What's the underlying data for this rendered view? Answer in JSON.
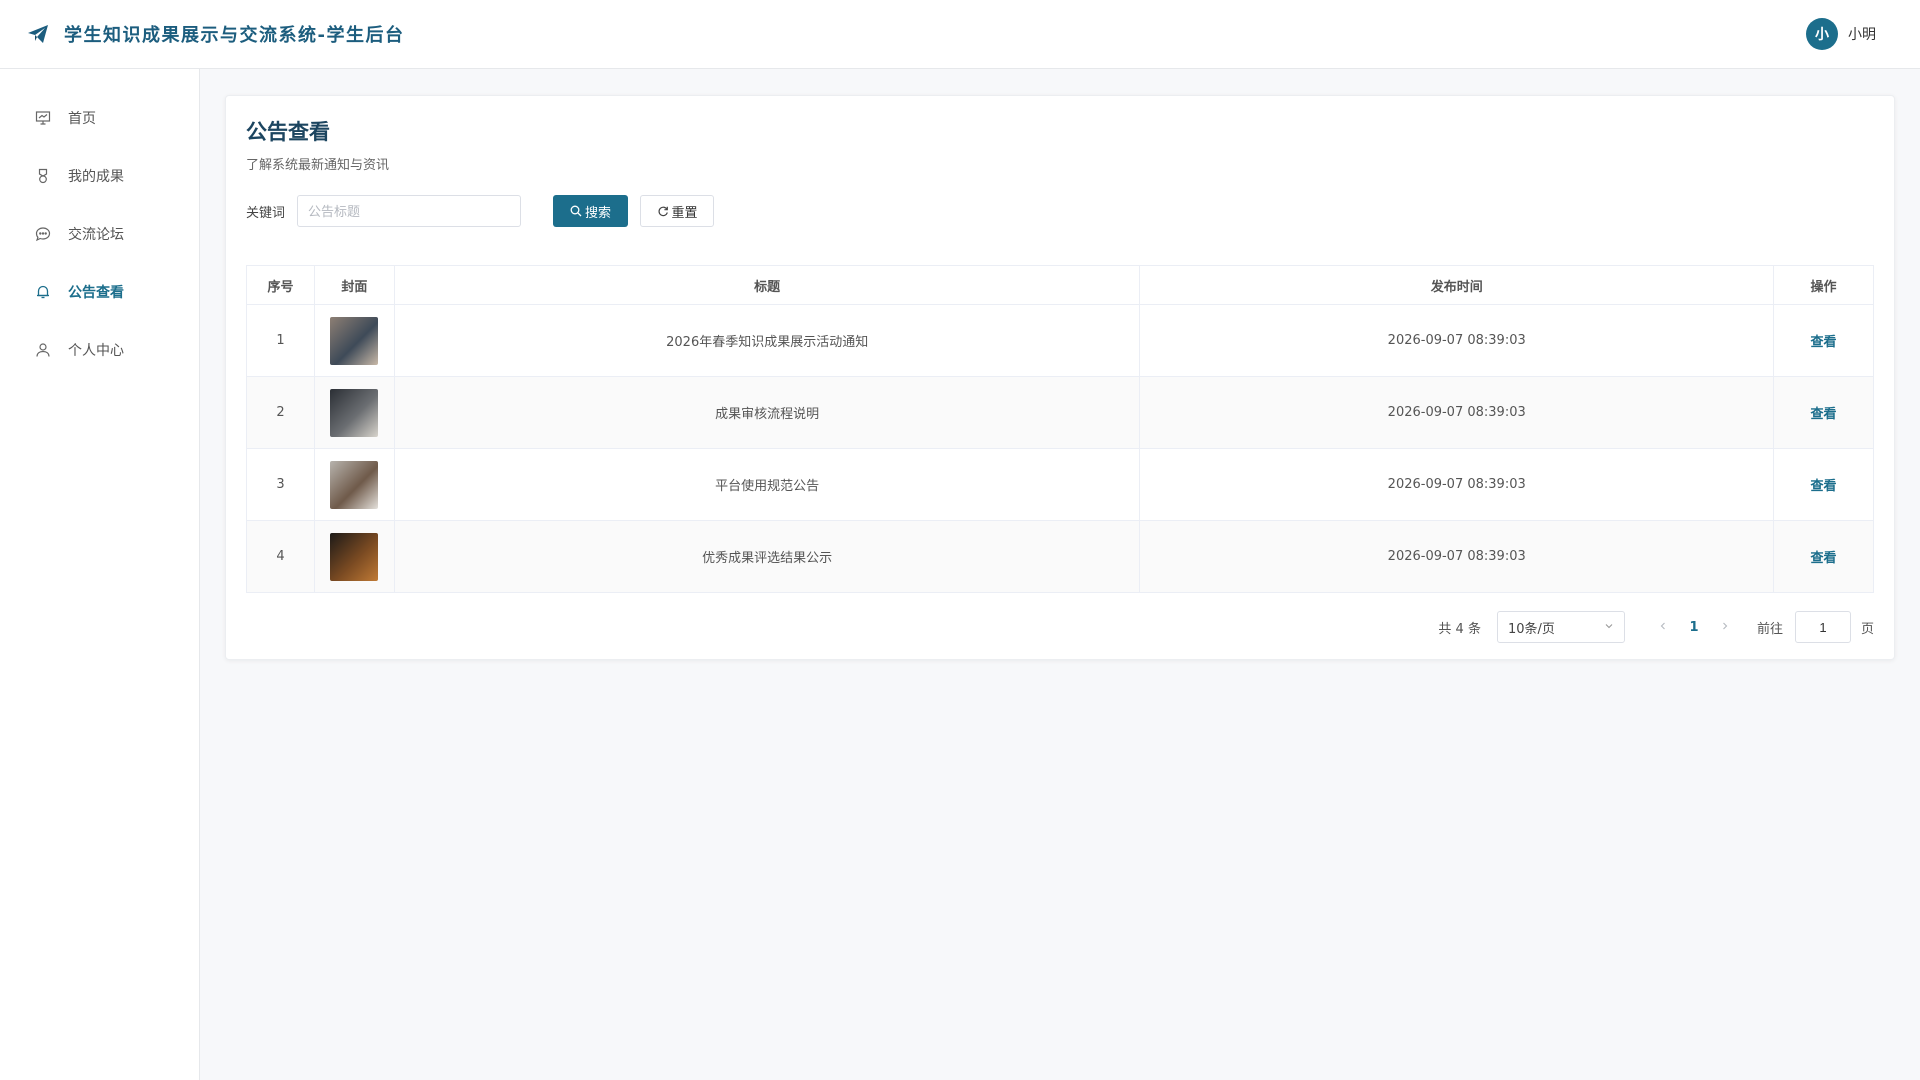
{
  "header": {
    "title": "学生知识成果展示与交流系统-学生后台",
    "avatar_text": "小",
    "user_name": "小明"
  },
  "sidebar": {
    "items": [
      {
        "label": "首页",
        "icon": "presentation-icon",
        "active": false
      },
      {
        "label": "我的成果",
        "icon": "medal-icon",
        "active": false
      },
      {
        "label": "交流论坛",
        "icon": "chat-icon",
        "active": false
      },
      {
        "label": "公告查看",
        "icon": "bell-icon",
        "active": true
      },
      {
        "label": "个人中心",
        "icon": "user-icon",
        "active": false
      }
    ]
  },
  "main": {
    "title": "公告查看",
    "subtitle": "了解系统最新通知与资讯",
    "search": {
      "label": "关键词",
      "placeholder": "公告标题",
      "value": "",
      "search_label": "搜索",
      "reset_label": "重置"
    },
    "table": {
      "columns": [
        "序号",
        "封面",
        "标题",
        "发布时间",
        "操作"
      ],
      "rows": [
        {
          "index": "1",
          "title": "2026年春季知识成果展示活动通知",
          "time": "2026-09-07 08:39:03",
          "action": "查看",
          "thumb_colors": [
            "#8d7f74",
            "#3e4a58",
            "#c9b9a8"
          ]
        },
        {
          "index": "2",
          "title": "成果审核流程说明",
          "time": "2026-09-07 08:39:03",
          "action": "查看",
          "thumb_colors": [
            "#2b2f35",
            "#6b6e72",
            "#d8d4cc"
          ]
        },
        {
          "index": "3",
          "title": "平台使用规范公告",
          "time": "2026-09-07 08:39:03",
          "action": "查看",
          "thumb_colors": [
            "#b7b3ad",
            "#6f5a4a",
            "#e4e1dc"
          ]
        },
        {
          "index": "4",
          "title": "优秀成果评选结果公示",
          "time": "2026-09-07 08:39:03",
          "action": "查看",
          "thumb_colors": [
            "#1d1a18",
            "#7a4a22",
            "#c07a35"
          ]
        }
      ]
    },
    "pagination": {
      "total_text": "共 4 条",
      "page_size": "10条/页",
      "current_page": "1",
      "goto_label": "前往",
      "goto_value": "1",
      "page_label": "页"
    }
  },
  "colors": {
    "accent": "#1c6e8c",
    "title": "#1c5d7e"
  }
}
